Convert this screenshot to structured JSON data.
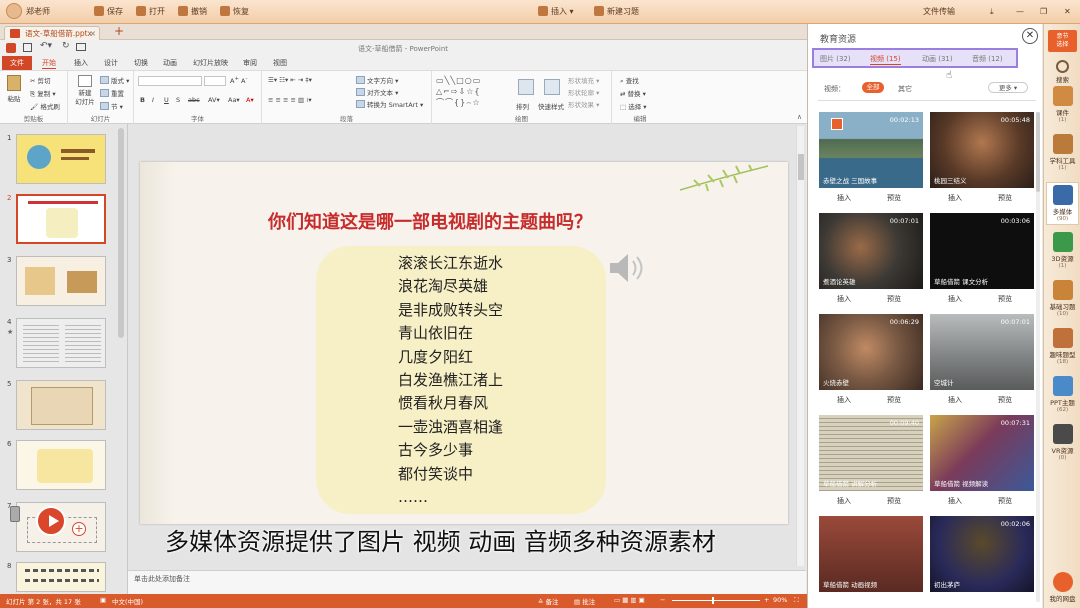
{
  "top": {
    "user": "郑老师",
    "save": "保存",
    "open": "打开",
    "undo": "撤销",
    "redo": "恢复",
    "insert": "插入",
    "new_exercise": "新建习题",
    "file_transfer": "文件传输"
  },
  "tab": {
    "doc": "语文-草船借箭.pptx",
    "add": "+"
  },
  "app_title": "语文-草船借箭 - PowerPoint",
  "login": "登录",
  "ribbon_tabs": [
    "文件",
    "开始",
    "插入",
    "设计",
    "切换",
    "动画",
    "幻灯片放映",
    "审阅",
    "视图"
  ],
  "ribbon": {
    "paste": "粘贴",
    "cut": "剪切",
    "copy": "复制",
    "format_painter": "格式刷",
    "clipboard": "剪贴板",
    "new_slide": "新建\n幻灯片",
    "layout": "版式",
    "reset": "重置",
    "section": "节",
    "slides": "幻灯片",
    "font": "字体",
    "text_direction": "文字方向",
    "align_text": "对齐文本",
    "to_smartart": "转换为 SmartArt",
    "paragraph": "段落",
    "arrange": "排列",
    "quick_styles": "快速样式",
    "shape_fill": "形状填充",
    "shape_outline": "形状轮廓",
    "shape_effects": "形状效果",
    "drawing": "绘图",
    "find": "查找",
    "replace": "替换",
    "select": "选择",
    "editing": "编辑"
  },
  "thumbs": [
    "1",
    "2",
    "3",
    "4",
    "5",
    "6",
    "7",
    "8"
  ],
  "slide": {
    "title": "你们知道这是哪一部电视剧的主题曲吗？",
    "lines": [
      "滚滚长江东逝水",
      "浪花淘尽英雄",
      "是非成败转头空",
      "青山依旧在",
      "几度夕阳红",
      "白发渔樵江渚上",
      "惯看秋月春风",
      "一壶浊酒喜相逢",
      "古今多少事",
      "都付笑谈中",
      "……"
    ]
  },
  "notes": "单击此处添加备注",
  "status": {
    "slide": "幻灯片 第 2 张，共 17 张",
    "lang": "中文(中国)",
    "notes": "备注",
    "comments": "批注",
    "zoom": "90%"
  },
  "edu": {
    "title": "教育资源",
    "tabs": [
      {
        "label": "图片",
        "count": "(32)"
      },
      {
        "label": "视频",
        "count": "(15)"
      },
      {
        "label": "动画",
        "count": "(31)"
      },
      {
        "label": "音频",
        "count": "(12)"
      }
    ],
    "filter_label": "视频：",
    "filter_all": "全部",
    "filter_other": "其它",
    "more": "更多",
    "insert": "插入",
    "preview": "预览",
    "cards": [
      {
        "title": "赤壁之战 三国故事",
        "duration": "00:02:13",
        "color": "#4d7a9a"
      },
      {
        "title": "桃园三结义",
        "duration": "00:05:48",
        "color": "#6b5a40"
      },
      {
        "title": "煮酒论英雄",
        "duration": "00:07:01",
        "color": "#3d3a35"
      },
      {
        "title": "草船借箭 课文分析",
        "duration": "00:03:06",
        "color": "#1a1a1a"
      },
      {
        "title": "火烧赤壁",
        "duration": "00:06:29",
        "color": "#7a5a44"
      },
      {
        "title": "空城计",
        "duration": "00:07:01",
        "color": "#8d9090"
      },
      {
        "title": "草船借箭 讲解分析",
        "duration": "00:09:40",
        "color": "#c9c3b0"
      },
      {
        "title": "草船借箭 视频解读",
        "duration": "00:07:31",
        "color": "#6b4a6a"
      },
      {
        "title": "草船借箭 动画视频",
        "duration": "",
        "color": "#7a4a3a"
      },
      {
        "title": "初出茅庐",
        "duration": "00:02:06",
        "color": "#2a2a5a"
      }
    ]
  },
  "rightbar": {
    "top_btn": "意节\n选择",
    "search": "搜索",
    "items": [
      {
        "label": "课件",
        "count": "(1)"
      },
      {
        "label": "学科工具",
        "count": "(1)"
      },
      {
        "label": "多媒体",
        "count": "(90)"
      },
      {
        "label": "3D资源",
        "count": "(1)"
      },
      {
        "label": "基础习题",
        "count": "(10)"
      },
      {
        "label": "趣味题型",
        "count": "(18)"
      },
      {
        "label": "PPT主题",
        "count": "(62)"
      },
      {
        "label": "VR资源",
        "count": "(0)"
      }
    ],
    "cloud": "我的网盘"
  },
  "subtitle": "多媒体资源提供了图片   视频   动画   音频多种资源素材"
}
